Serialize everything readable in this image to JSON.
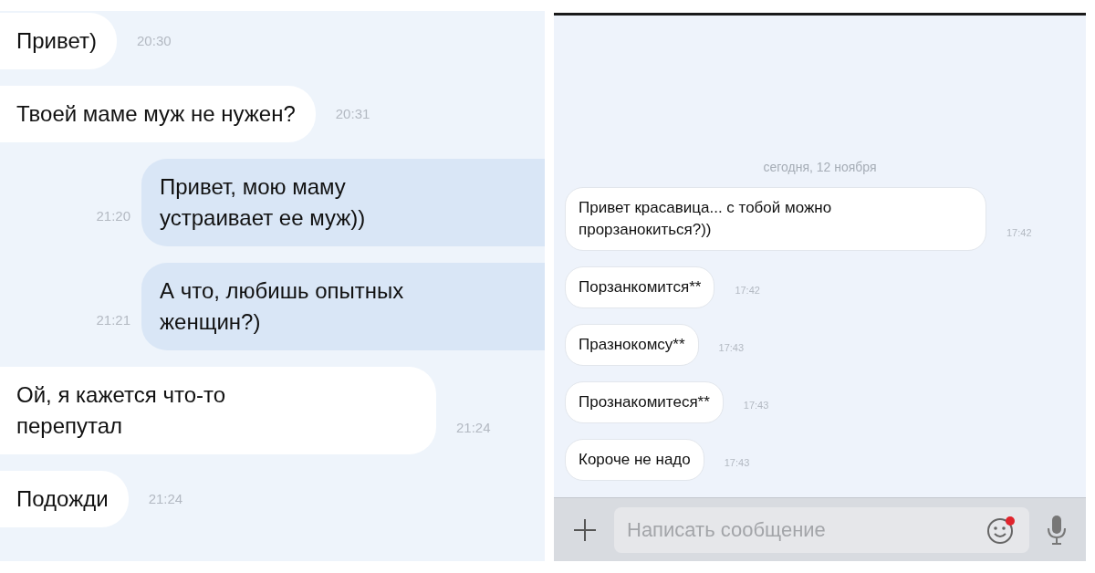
{
  "left_chat": {
    "messages": [
      {
        "kind": "in",
        "text": "Привет)",
        "time": "20:30"
      },
      {
        "kind": "in",
        "text": "Твоей маме муж не нужен?",
        "time": "20:31"
      },
      {
        "kind": "out",
        "text": "Привет, мою маму\nустраивает ее муж))",
        "time": "21:20"
      },
      {
        "kind": "out",
        "text": "А что, любишь опытных\nженщин?)",
        "time": "21:21"
      },
      {
        "kind": "in",
        "text": "Ой, я кажется что-то\nперепутал",
        "time": "21:24"
      },
      {
        "kind": "in",
        "text": "Подожди",
        "time": "21:24"
      }
    ]
  },
  "right_chat": {
    "date": "сегодня, 12 ноября",
    "messages": [
      {
        "kind": "in",
        "text": "Привет красавица... с тобой можно\nпрорзанокиться?))",
        "time": "17:42"
      },
      {
        "kind": "in",
        "text": "Порзанкомится**",
        "time": "17:42"
      },
      {
        "kind": "in",
        "text": "Празнокомсу**",
        "time": "17:43"
      },
      {
        "kind": "in",
        "text": "Прознакомитеся**",
        "time": "17:43"
      },
      {
        "kind": "in",
        "text": "Короче не надо",
        "time": "17:43"
      }
    ],
    "composer": {
      "placeholder": "Написать сообщение",
      "emoji_notification": true
    }
  }
}
